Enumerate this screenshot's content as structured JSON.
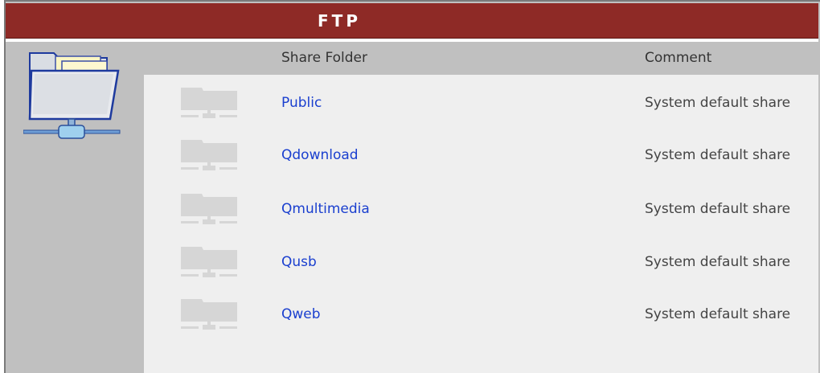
{
  "header": {
    "title": "FTP"
  },
  "table": {
    "columns": {
      "share_folder": "Share Folder",
      "comment": "Comment"
    },
    "rows": [
      {
        "name": "Public",
        "comment": "System default share",
        "icon": "folder-icon"
      },
      {
        "name": "Qdownload",
        "comment": "System default share",
        "icon": "folder-icon"
      },
      {
        "name": "Qmultimedia",
        "comment": "System default share",
        "icon": "folder-icon"
      },
      {
        "name": "Qusb",
        "comment": "System default share",
        "icon": "folder-icon"
      },
      {
        "name": "Qweb",
        "comment": "System default share",
        "icon": "folder-icon"
      }
    ]
  },
  "left_panel": {
    "icon": "ftp-network-folder-icon"
  },
  "colors": {
    "title_bar": "#8e2a26",
    "link": "#1a3fcf",
    "panel": "#c0c0c0",
    "content": "#efefef"
  }
}
